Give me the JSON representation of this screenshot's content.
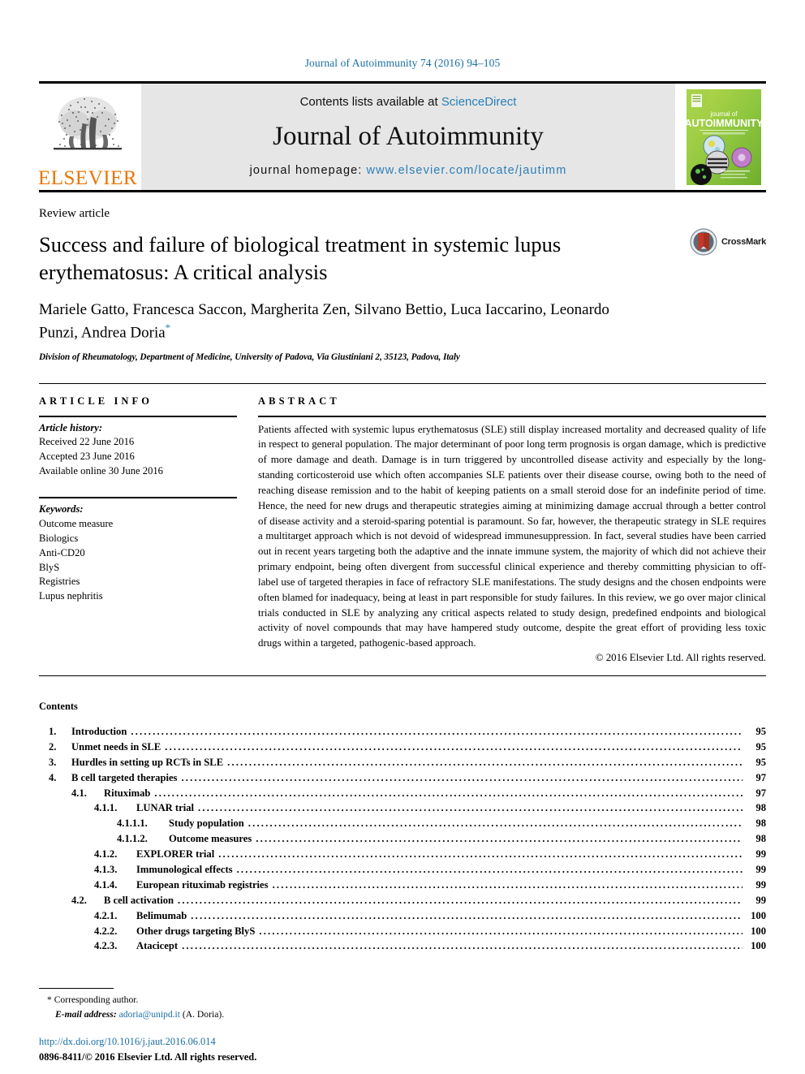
{
  "running_head": "Journal of Autoimmunity 74 (2016) 94–105",
  "masthead": {
    "publisher_logo_label": "ELSEVIER",
    "contents_prefix": "Contents lists available at ",
    "contents_link": "ScienceDirect",
    "journal_title": "Journal of Autoimmunity",
    "homepage_prefix": "journal homepage: ",
    "homepage_url": "www.elsevier.com/locate/jautimm",
    "cover": {
      "line1": "journal of",
      "line2": "AUTOIMMUNITY"
    }
  },
  "article": {
    "type_tag": "Review article",
    "title": "Success and failure of biological treatment in systemic lupus erythematosus: A critical analysis",
    "authors": "Mariele Gatto, Francesca Saccon, Margherita Zen, Silvano Bettio, Luca Iaccarino, Leonardo Punzi, Andrea Doria",
    "corresponding_marker": "*",
    "affiliation": "Division of Rheumatology, Department of Medicine, University of Padova, Via Giustiniani 2, 35123, Padova, Italy",
    "crossmark_label": "CrossMark"
  },
  "article_info": {
    "heading": "ARTICLE INFO",
    "history_label": "Article history:",
    "history": [
      "Received 22 June 2016",
      "Accepted 23 June 2016",
      "Available online 30 June 2016"
    ],
    "keywords_label": "Keywords:",
    "keywords": [
      "Outcome measure",
      "Biologics",
      "Anti-CD20",
      "BlyS",
      "Registries",
      "Lupus nephritis"
    ]
  },
  "abstract": {
    "heading": "ABSTRACT",
    "text": "Patients affected with systemic lupus erythematosus (SLE) still display increased mortality and decreased quality of life in respect to general population. The major determinant of poor long term prognosis is organ damage, which is predictive of more damage and death. Damage is in turn triggered by uncontrolled disease activity and especially by the long-standing corticosteroid use which often accompanies SLE patients over their disease course, owing both to the need of reaching disease remission and to the habit of keeping patients on a small steroid dose for an indefinite period of time. Hence, the need for new drugs and therapeutic strategies aiming at minimizing damage accrual through a better control of disease activity and a steroid-sparing potential is paramount. So far, however, the therapeutic strategy in SLE requires a multitarget approach which is not devoid of widespread immunesuppression. In fact, several studies have been carried out in recent years targeting both the adaptive and the innate immune system, the majority of which did not achieve their primary endpoint, being often divergent from successful clinical experience and thereby committing physician to off-label use of targeted therapies in face of refractory SLE manifestations. The study designs and the chosen endpoints were often blamed for inadequacy, being at least in part responsible for study failures. In this review, we go over major clinical trials conducted in SLE by analyzing any critical aspects related to study design, predefined endpoints and biological activity of novel compounds that may have hampered study outcome, despite the great effort of providing less toxic drugs within a targeted, pathogenic-based approach.",
    "copyright": "© 2016 Elsevier Ltd. All rights reserved."
  },
  "contents": {
    "heading": "Contents",
    "items": [
      {
        "level": 1,
        "number": "1.",
        "label": "Introduction",
        "page": "95"
      },
      {
        "level": 1,
        "number": "2.",
        "label": "Unmet needs in SLE",
        "page": "95"
      },
      {
        "level": 1,
        "number": "3.",
        "label": "Hurdles in setting up RCTs in SLE",
        "page": "95"
      },
      {
        "level": 1,
        "number": "4.",
        "label": "B cell targeted therapies",
        "page": "97"
      },
      {
        "level": 2,
        "number": "4.1.",
        "label": "Rituximab",
        "page": "97"
      },
      {
        "level": 3,
        "number": "4.1.1.",
        "label": "LUNAR trial",
        "page": "98"
      },
      {
        "level": 4,
        "number": "4.1.1.1.",
        "label": "Study population",
        "page": "98"
      },
      {
        "level": 4,
        "number": "4.1.1.2.",
        "label": "Outcome measures",
        "page": "98"
      },
      {
        "level": 3,
        "number": "4.1.2.",
        "label": "EXPLORER trial",
        "page": "99"
      },
      {
        "level": 3,
        "number": "4.1.3.",
        "label": "Immunological effects",
        "page": "99"
      },
      {
        "level": 3,
        "number": "4.1.4.",
        "label": "European rituximab registries",
        "page": "99"
      },
      {
        "level": 2,
        "number": "4.2.",
        "label": "B cell activation",
        "page": "99"
      },
      {
        "level": 3,
        "number": "4.2.1.",
        "label": "Belimumab",
        "page": "100"
      },
      {
        "level": 3,
        "number": "4.2.2.",
        "label": "Other drugs targeting BlyS",
        "page": "100"
      },
      {
        "level": 3,
        "number": "4.2.3.",
        "label": "Atacicept",
        "page": "100"
      }
    ]
  },
  "footnotes": {
    "corresponding_marker": "*",
    "corresponding_text": "Corresponding author.",
    "email_label": "E-mail address:",
    "email": "adoria@unipd.it",
    "email_suffix": "(A. Doria).",
    "doi": "http://dx.doi.org/10.1016/j.jaut.2016.06.014",
    "issn_line": "0896-8411/© 2016 Elsevier Ltd. All rights reserved."
  },
  "colors": {
    "link_blue": "#2a7fb8",
    "runhead_blue": "#1a6fa3",
    "elsevier_orange": "#ec7404",
    "masthead_grey": "#e6e6e6",
    "cover_green": "#8dc63f",
    "crossmark_red": "#c0392b"
  }
}
